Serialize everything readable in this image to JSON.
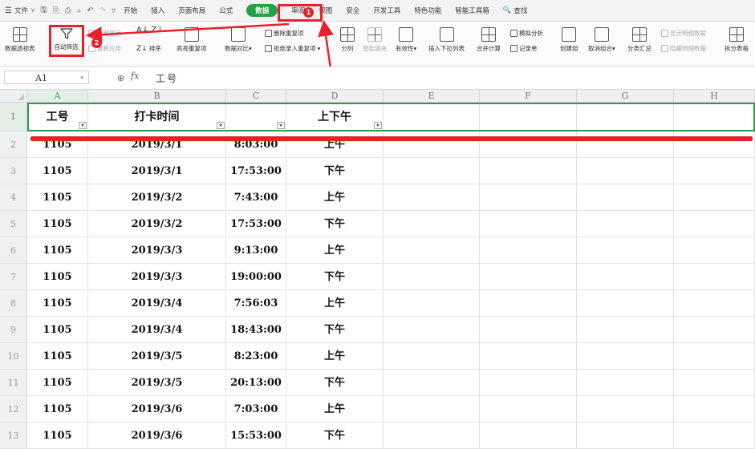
{
  "menu": {
    "file_label": "文件",
    "chevron": "∨"
  },
  "tabs": [
    {
      "label": "开始",
      "active": false
    },
    {
      "label": "插入",
      "active": false
    },
    {
      "label": "页面布局",
      "active": false
    },
    {
      "label": "公式",
      "active": false
    },
    {
      "label": "数据",
      "active": true
    },
    {
      "label": "审阅",
      "active": false
    },
    {
      "label": "视图",
      "active": false
    },
    {
      "label": "安全",
      "active": false
    },
    {
      "label": "开发工具",
      "active": false
    },
    {
      "label": "特色功能",
      "active": false
    },
    {
      "label": "智能工具箱",
      "active": false
    }
  ],
  "search_label": "查找",
  "ribbon": {
    "pivot": "数据透视表",
    "autofilter": "自动筛选",
    "show_all": "全部显示",
    "reapply": "重新应用",
    "sort": "排序",
    "highlight_dup": "高亮重复项",
    "compare": "数据对比",
    "remove_dup": "删除重复项",
    "reject_dup": "拒绝录入重复项",
    "split": "分列",
    "smart_fill": "智能填充",
    "validity": "有效性",
    "dropdown": "插入下拉列表",
    "consolidate": "合并计算",
    "whatif": "模拟分析",
    "record": "记录单",
    "group": "创建组",
    "ungroup": "取消组合",
    "subtotal": "分类汇总",
    "show_detail": "显示明细数据",
    "hide_detail": "隐藏明细数据",
    "split_table": "拆分表格"
  },
  "annotations": {
    "badge1": "1",
    "badge2": "2"
  },
  "formula_bar": {
    "cell_ref": "A1",
    "fx": "fx",
    "value": "工号"
  },
  "columns": [
    "A",
    "B",
    "C",
    "D",
    "E",
    "F",
    "G",
    "H"
  ],
  "header_row": [
    "工号",
    "打卡时间",
    "",
    "上下午"
  ],
  "row_numbers": [
    "1",
    "2",
    "3",
    "4",
    "5",
    "6",
    "7",
    "8",
    "9",
    "10",
    "11",
    "12",
    "13"
  ],
  "rows": [
    [
      "1105",
      "2019/3/1",
      "8:03:00",
      "上午"
    ],
    [
      "1105",
      "2019/3/1",
      "17:53:00",
      "下午"
    ],
    [
      "1105",
      "2019/3/2",
      "7:43:00",
      "上午"
    ],
    [
      "1105",
      "2019/3/2",
      "17:53:00",
      "下午"
    ],
    [
      "1105",
      "2019/3/3",
      "9:13:00",
      "上午"
    ],
    [
      "1105",
      "2019/3/3",
      "19:00:00",
      "下午"
    ],
    [
      "1105",
      "2019/3/4",
      "7:56:03",
      "上午"
    ],
    [
      "1105",
      "2019/3/4",
      "18:43:00",
      "下午"
    ],
    [
      "1105",
      "2019/3/5",
      "8:23:00",
      "上午"
    ],
    [
      "1105",
      "2019/3/5",
      "20:13:00",
      "下午"
    ],
    [
      "1105",
      "2019/3/6",
      "7:03:00",
      "上午"
    ],
    [
      "1105",
      "2019/3/6",
      "15:53:00",
      "下午"
    ]
  ],
  "colors": {
    "accent_green": "#23a348",
    "annotation_red": "#e8202a",
    "selection_green": "#2e9c4f"
  },
  "icons": [
    "menu-icon",
    "save-icon",
    "print-icon",
    "undo-icon",
    "redo-icon",
    "filter-icon",
    "search-icon",
    "fx-icon"
  ]
}
